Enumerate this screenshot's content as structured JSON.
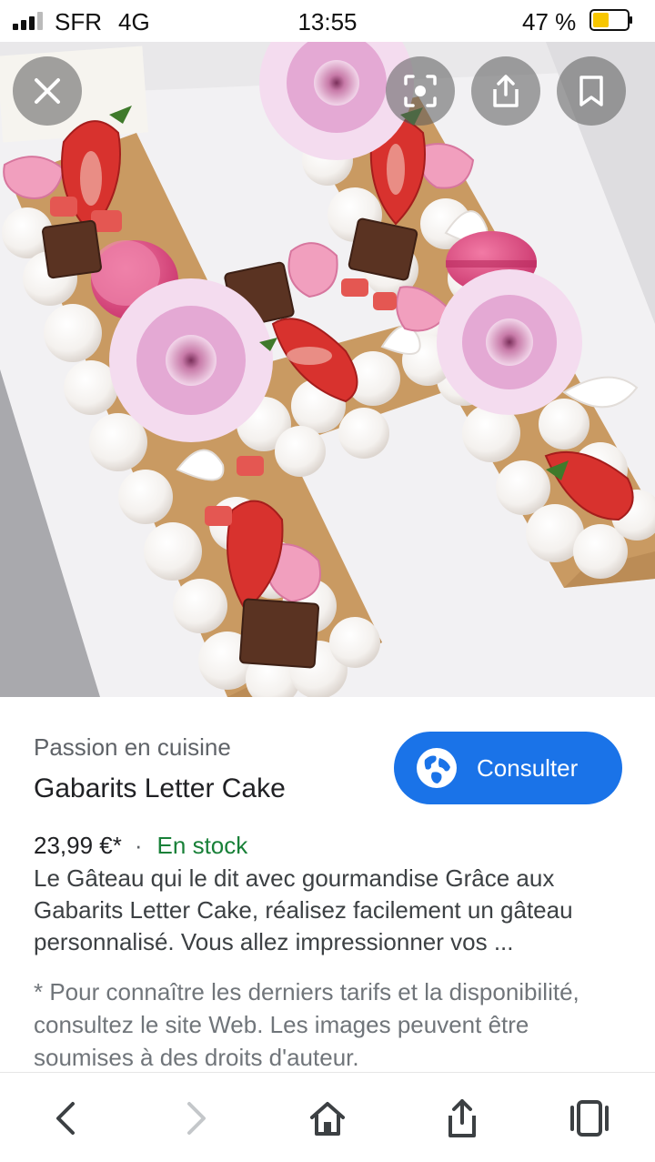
{
  "status_bar": {
    "carrier": "SFR",
    "network": "4G",
    "time": "13:55",
    "battery_percent": "47 %",
    "battery_level": 0.47,
    "battery_color": "#f7c600"
  },
  "image_overlay": {
    "close_icon": "close-icon",
    "lens_icon": "lens-icon",
    "share_icon": "share-icon",
    "save_icon": "bookmark-icon"
  },
  "result": {
    "source": "Passion en cuisine",
    "title": "Gabarits Letter Cake",
    "price": "23,99 €*",
    "separator": "·",
    "availability": "En stock",
    "description": "Le Gâteau qui le dit avec gourmandise Grâce aux Gabarits Letter Cake, réalisez facilement un gâteau personnalisé. Vous allez impressionner vos ...",
    "disclaimer": "* Pour connaître les derniers tarifs et la disponibilité, consultez le site Web. Les images peuvent être soumises à des droits d'auteur.",
    "consult_label": "Consulter",
    "accent_color": "#1a73e8",
    "stock_color": "#188038"
  },
  "bottom_nav": {
    "items": [
      "back-icon",
      "forward-icon",
      "home-icon",
      "share-icon",
      "tabs-icon"
    ]
  }
}
